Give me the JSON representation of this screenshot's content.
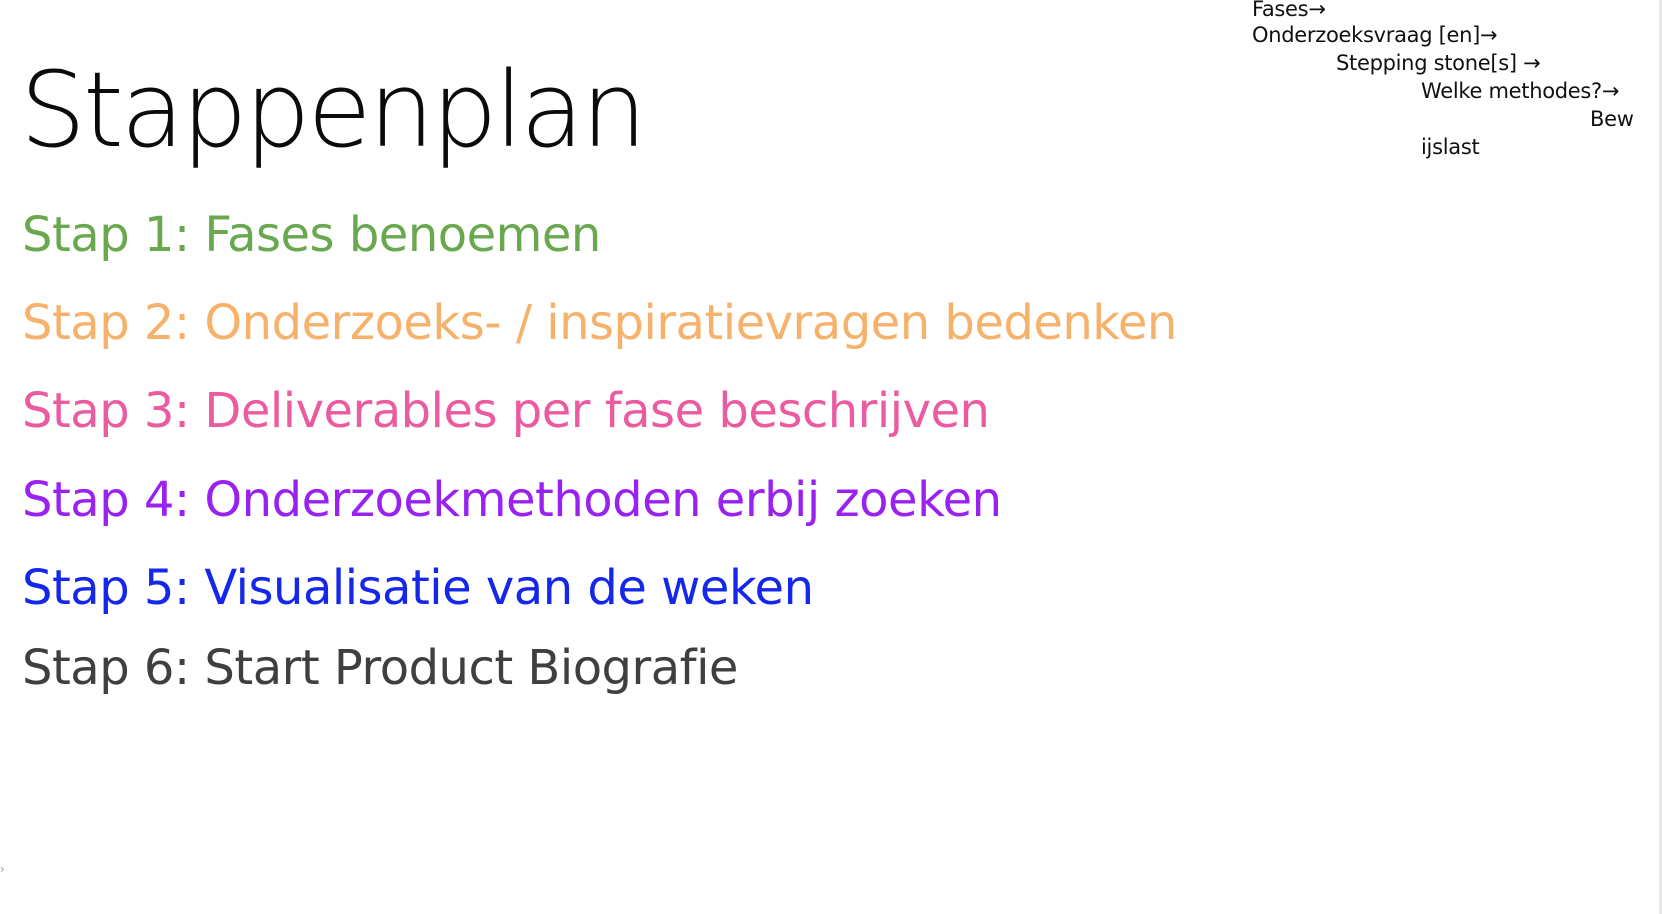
{
  "slide": {
    "title": "Stappenplan",
    "steps": [
      {
        "label": "Stap 1: Fases benoemen",
        "color": "#6aa84f"
      },
      {
        "label": "Stap 2: Onderzoeks- / inspiratievragen bedenken",
        "color": "#f6b26b"
      },
      {
        "label": "Stap 3: Deliverables per fase beschrijven",
        "color": "#ea5b9f"
      },
      {
        "label": "Stap 4: Onderzoekmethoden erbij zoeken",
        "color": "#9a22f0"
      },
      {
        "label": "Stap 5: Visualisatie van de weken",
        "color": "#1528ea"
      },
      {
        "label": "Stap 6: Start Product Biografie",
        "color": "#3f3f3f"
      }
    ],
    "flow_notes": [
      "Fases→",
      "Onderzoeksvraag [en]→",
      "Stepping stone[s] →",
      "Welke methodes?→",
      "Bew",
      "ijslast"
    ]
  }
}
